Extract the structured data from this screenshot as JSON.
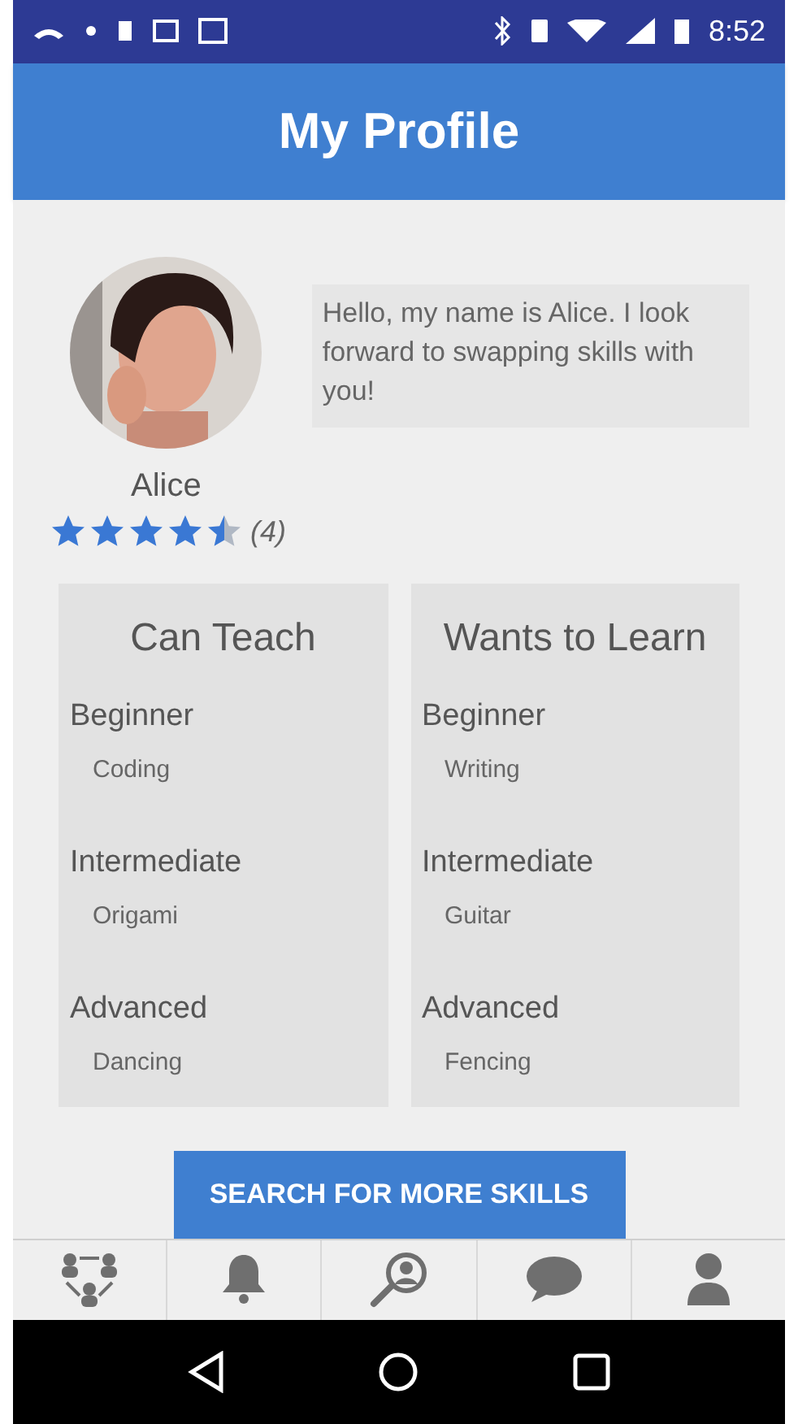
{
  "status_bar": {
    "time": "8:52"
  },
  "header": {
    "title": "My Profile"
  },
  "profile": {
    "name": "Alice",
    "stars": 4.5,
    "rating_count": "(4)",
    "bio": "Hello, my name is Alice. I look forward to swapping skills with you!"
  },
  "skill_panels": [
    {
      "title": "Can Teach",
      "levels": [
        {
          "label": "Beginner",
          "skill": "Coding"
        },
        {
          "label": "Intermediate",
          "skill": "Origami"
        },
        {
          "label": "Advanced",
          "skill": "Dancing"
        }
      ]
    },
    {
      "title": "Wants to Learn",
      "levels": [
        {
          "label": "Beginner",
          "skill": "Writing"
        },
        {
          "label": "Intermediate",
          "skill": "Guitar"
        },
        {
          "label": "Advanced",
          "skill": "Fencing"
        }
      ]
    }
  ],
  "search_button": {
    "label": "SEARCH FOR MORE SKILLS"
  },
  "bottom_nav": [
    {
      "kind": "network"
    },
    {
      "kind": "notifications"
    },
    {
      "kind": "search"
    },
    {
      "kind": "messages"
    },
    {
      "kind": "profile"
    }
  ]
}
